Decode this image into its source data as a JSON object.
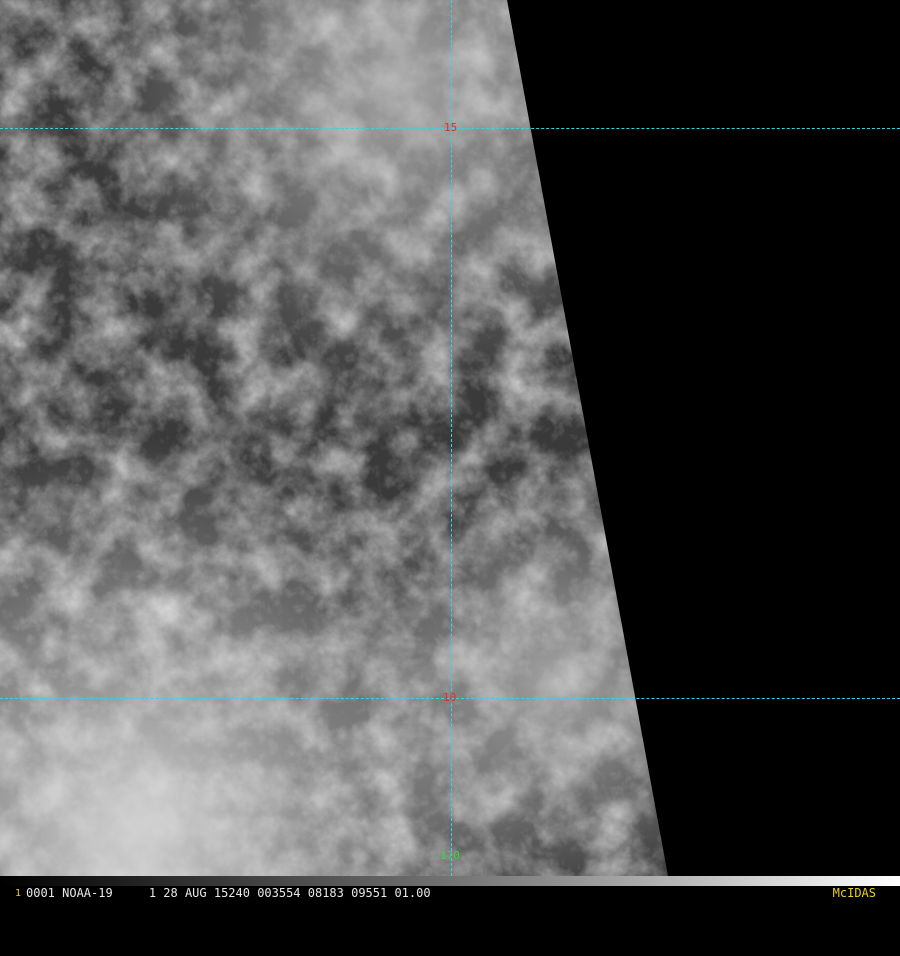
{
  "image": {
    "kind": "satellite-visible-imagery",
    "palette": {
      "grid": "#2fd6e6",
      "lat_label": "#e0302a",
      "lon_label": "#30e030",
      "status_text": "#e8e8e8",
      "logo": "#e8d020"
    }
  },
  "grid": {
    "latitudes": [
      {
        "label": "15"
      },
      {
        "label": "10"
      }
    ],
    "longitudes": [
      {
        "label": "170"
      }
    ]
  },
  "status_bar": {
    "frame_number": "1",
    "text": "0001 NOAA-19     1 28 AUG 15240 003554 08183 09551 01.00",
    "logo": "McIDAS"
  }
}
